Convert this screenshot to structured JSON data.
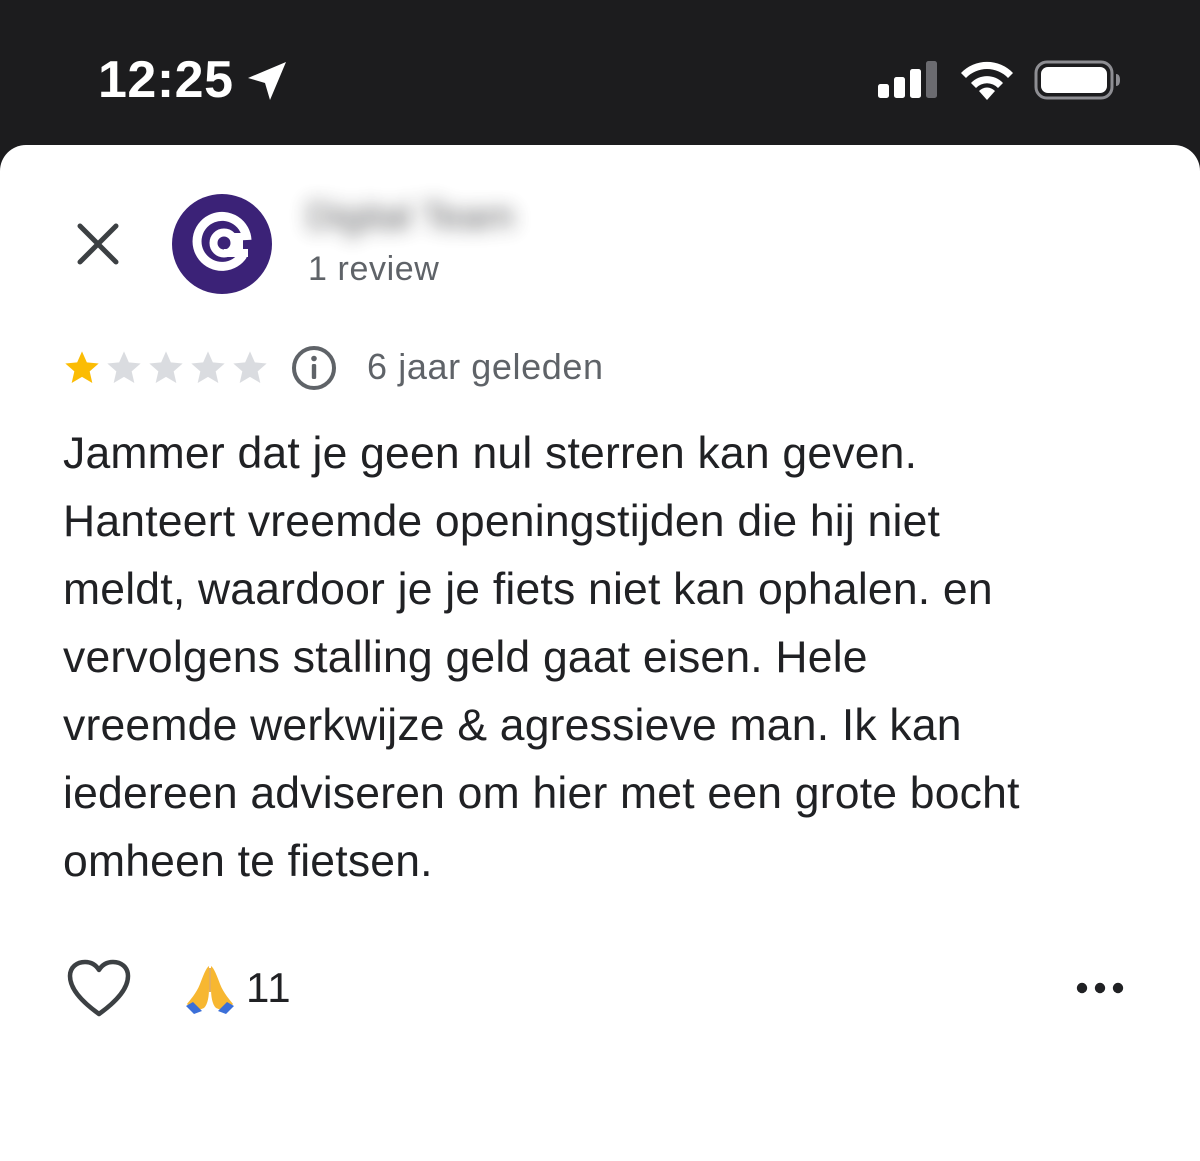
{
  "status_bar": {
    "time": "12:25",
    "location_icon": "location-arrow-icon",
    "signal_icon": "cellular-signal-icon",
    "wifi_icon": "wifi-icon",
    "battery_icon": "battery-icon"
  },
  "header": {
    "close_icon": "close-icon",
    "avatar_icon": "at-sign-logo",
    "reviewer_name": "Digital Team",
    "review_count": "1 review"
  },
  "review": {
    "rating": 1,
    "rating_max": 5,
    "star_filled_color": "#fbbc04",
    "star_empty_color": "#dadce0",
    "info_icon": "info-icon",
    "date": "6 jaar geleden",
    "text_lines": [
      "Jammer dat je geen nul sterren kan geven.",
      "Hanteert vreemde openingstijden die hij niet",
      "meldt, waardoor je je fiets niet kan ophalen. en",
      "vervolgens stalling geld gaat eisen. Hele",
      "vreemde werkwijze & agressieve man. Ik kan",
      "iedereen adviseren om hier met een grote bocht",
      "omheen te fietsen."
    ]
  },
  "actions": {
    "like_icon": "heart-icon",
    "reaction_icon": "folded-hands-icon",
    "reaction_count": "11",
    "more_icon": "more-horizontal-icon"
  }
}
